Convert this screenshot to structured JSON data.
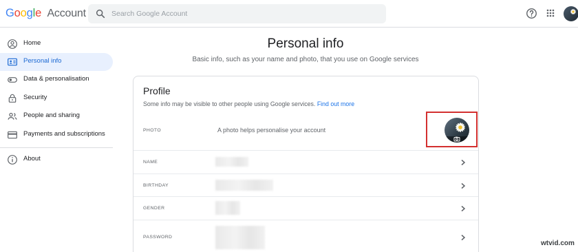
{
  "header": {
    "logo_letters": [
      "G",
      "o",
      "o",
      "g",
      "l",
      "e"
    ],
    "logo_colors": [
      "#4285f4",
      "#ea4335",
      "#fbbc05",
      "#4285f4",
      "#34a853",
      "#ea4335"
    ],
    "logo_suffix": "Account",
    "search_placeholder": "Search Google Account",
    "search_icon": "search-icon",
    "help_icon": "help-icon",
    "apps_icon": "apps-grid-icon"
  },
  "sidebar": {
    "items": [
      {
        "label": "Home",
        "icon": "home-icon",
        "active": false
      },
      {
        "label": "Personal info",
        "icon": "id-card-icon",
        "active": true
      },
      {
        "label": "Data & personalisation",
        "icon": "toggle-icon",
        "active": false
      },
      {
        "label": "Security",
        "icon": "lock-icon",
        "active": false
      },
      {
        "label": "People and sharing",
        "icon": "people-icon",
        "active": false
      },
      {
        "label": "Payments and subscriptions",
        "icon": "credit-card-icon",
        "active": false
      },
      {
        "label": "About",
        "icon": "info-icon",
        "active": false
      }
    ]
  },
  "main": {
    "title": "Personal info",
    "subtitle": "Basic info, such as your name and photo, that you use on Google services",
    "profile": {
      "title": "Profile",
      "description": "Some info may be visible to other people using Google services.",
      "link": "Find out more",
      "rows": [
        {
          "label": "PHOTO",
          "value": "A photo helps personalise your account"
        },
        {
          "label": "NAME",
          "value": ""
        },
        {
          "label": "BIRTHDAY",
          "value": ""
        },
        {
          "label": "GENDER",
          "value": ""
        },
        {
          "label": "PASSWORD",
          "value": ""
        }
      ]
    }
  },
  "colors": {
    "accent": "#1a73e8",
    "active_bg": "#e8f0fe",
    "highlight_box": "#d32f2f"
  },
  "watermark": "wtvid.com"
}
